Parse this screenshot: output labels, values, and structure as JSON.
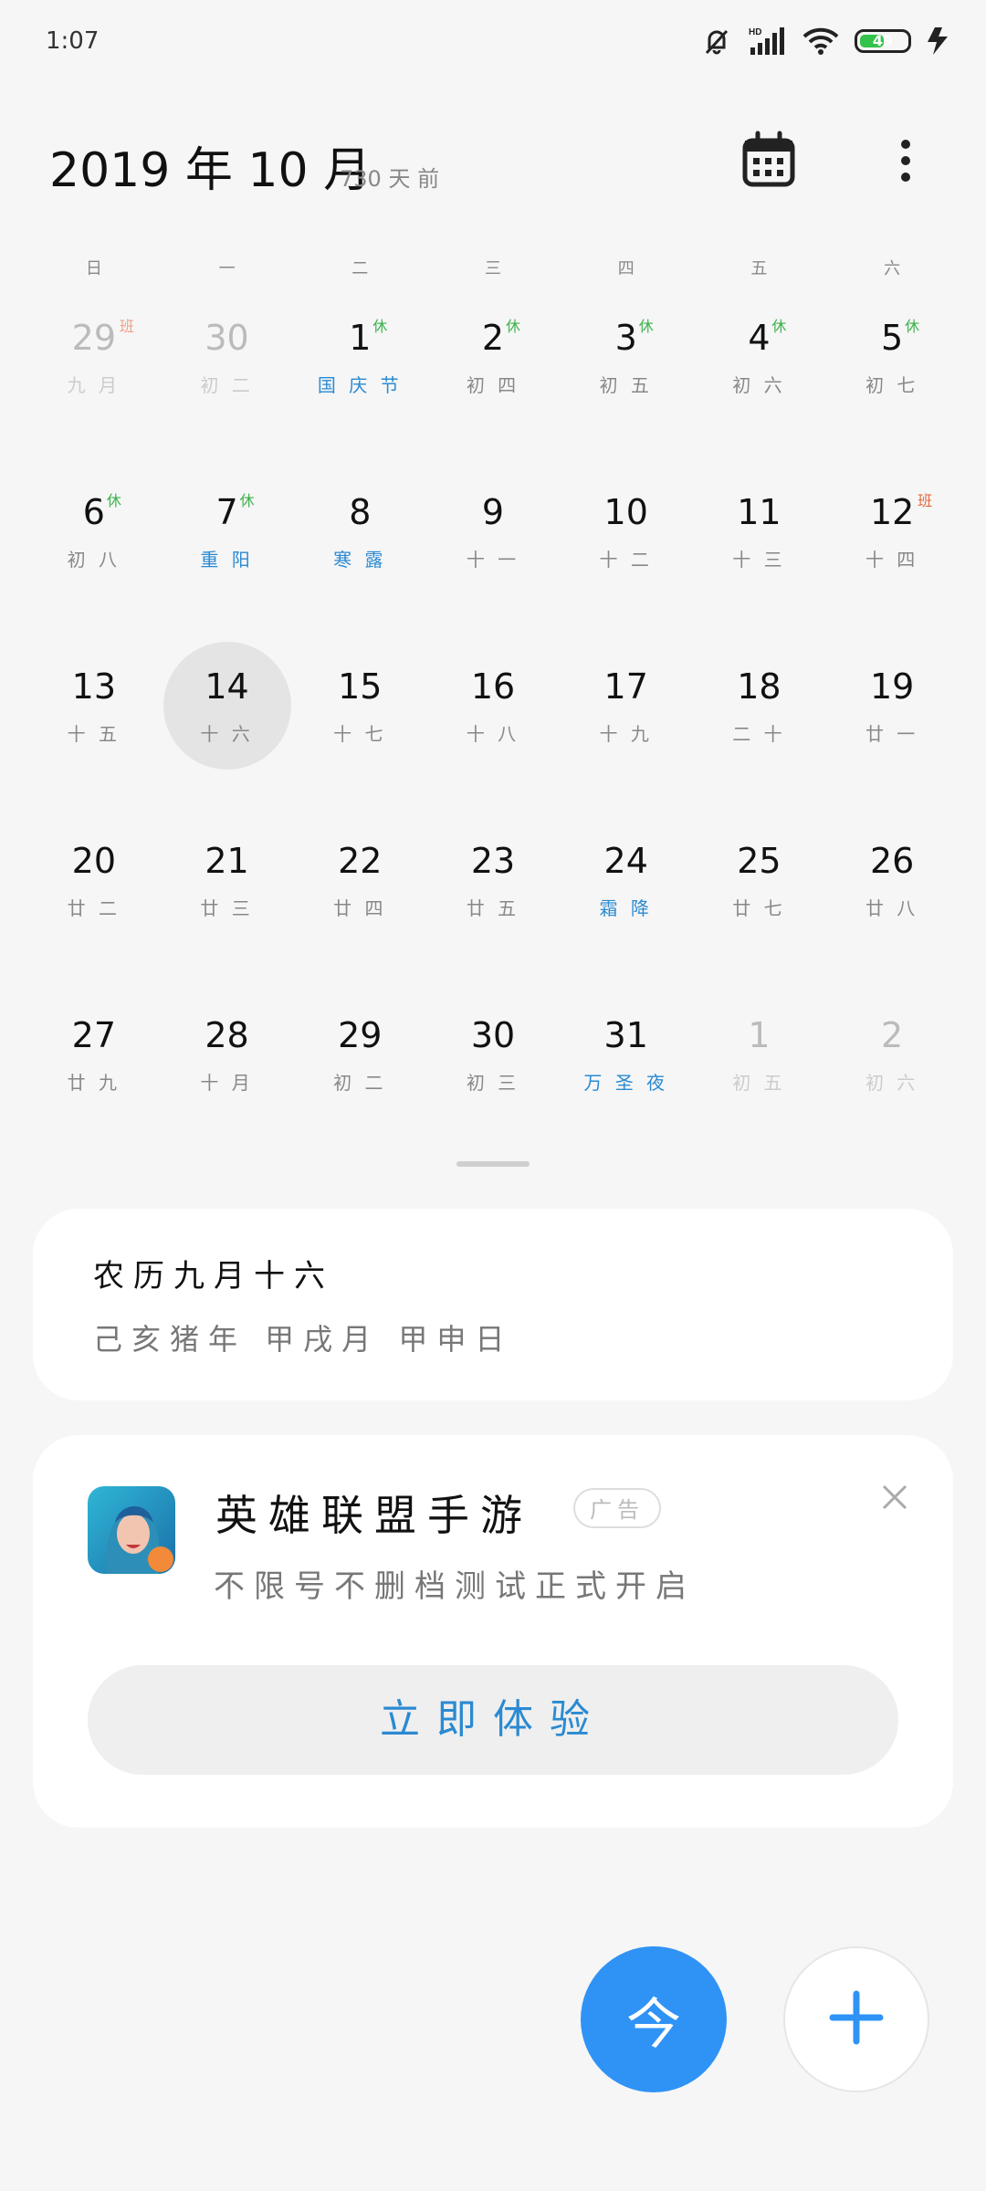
{
  "status": {
    "time": "1:07",
    "battery": "49",
    "battery_level": 0.49,
    "icons": [
      "notifications-off-icon",
      "hd-signal-icon",
      "wifi-icon",
      "battery-icon",
      "charging-icon"
    ]
  },
  "header": {
    "title": "2019 年 10 月",
    "subtitle": "730 天 前",
    "calendar_icon": "calendar-icon",
    "more_icon": "more-vertical-icon"
  },
  "weekdays": [
    "日",
    "一",
    "二",
    "三",
    "四",
    "五",
    "六"
  ],
  "days": [
    {
      "num": "29",
      "lunar": "九 月",
      "badge": "班",
      "badge_type": "work",
      "other": true
    },
    {
      "num": "30",
      "lunar": "初 二",
      "other": true
    },
    {
      "num": "1",
      "lunar": "国 庆 节",
      "badge": "休",
      "badge_type": "rest",
      "fest": true
    },
    {
      "num": "2",
      "lunar": "初 四",
      "badge": "休",
      "badge_type": "rest"
    },
    {
      "num": "3",
      "lunar": "初 五",
      "badge": "休",
      "badge_type": "rest"
    },
    {
      "num": "4",
      "lunar": "初 六",
      "badge": "休",
      "badge_type": "rest"
    },
    {
      "num": "5",
      "lunar": "初 七",
      "badge": "休",
      "badge_type": "rest"
    },
    {
      "num": "6",
      "lunar": "初 八",
      "badge": "休",
      "badge_type": "rest"
    },
    {
      "num": "7",
      "lunar": "重 阳",
      "badge": "休",
      "badge_type": "rest",
      "fest": true
    },
    {
      "num": "8",
      "lunar": "寒 露",
      "fest": true
    },
    {
      "num": "9",
      "lunar": "十 一"
    },
    {
      "num": "10",
      "lunar": "十 二"
    },
    {
      "num": "11",
      "lunar": "十 三"
    },
    {
      "num": "12",
      "lunar": "十 四",
      "badge": "班",
      "badge_type": "work"
    },
    {
      "num": "13",
      "lunar": "十 五"
    },
    {
      "num": "14",
      "lunar": "十 六",
      "today": true
    },
    {
      "num": "15",
      "lunar": "十 七"
    },
    {
      "num": "16",
      "lunar": "十 八"
    },
    {
      "num": "17",
      "lunar": "十 九"
    },
    {
      "num": "18",
      "lunar": "二 十"
    },
    {
      "num": "19",
      "lunar": "廿 一"
    },
    {
      "num": "20",
      "lunar": "廿 二"
    },
    {
      "num": "21",
      "lunar": "廿 三"
    },
    {
      "num": "22",
      "lunar": "廿 四"
    },
    {
      "num": "23",
      "lunar": "廿 五"
    },
    {
      "num": "24",
      "lunar": "霜 降",
      "fest": true
    },
    {
      "num": "25",
      "lunar": "廿 七"
    },
    {
      "num": "26",
      "lunar": "廿 八"
    },
    {
      "num": "27",
      "lunar": "廿 九"
    },
    {
      "num": "28",
      "lunar": "十 月"
    },
    {
      "num": "29",
      "lunar": "初 二"
    },
    {
      "num": "30",
      "lunar": "初 三"
    },
    {
      "num": "31",
      "lunar": "万 圣 夜",
      "fest": true
    },
    {
      "num": "1",
      "lunar": "初 五",
      "other": true
    },
    {
      "num": "2",
      "lunar": "初 六",
      "other": true
    }
  ],
  "lunar_card": {
    "line1": "农历九月十六",
    "line2": "己亥猪年 甲戌月 甲申日"
  },
  "ad_card": {
    "app_name": "英雄联盟手游",
    "tag": "广告",
    "description": "不限号不删档测试正式开启",
    "cta": "立即体验",
    "close_icon": "close-icon"
  },
  "fab": {
    "today_label": "今",
    "add_icon": "plus-icon"
  },
  "colors": {
    "accent": "#2f93f5",
    "festival": "#2a8ad2",
    "rest": "#3cb24b",
    "work": "#e8673a"
  }
}
